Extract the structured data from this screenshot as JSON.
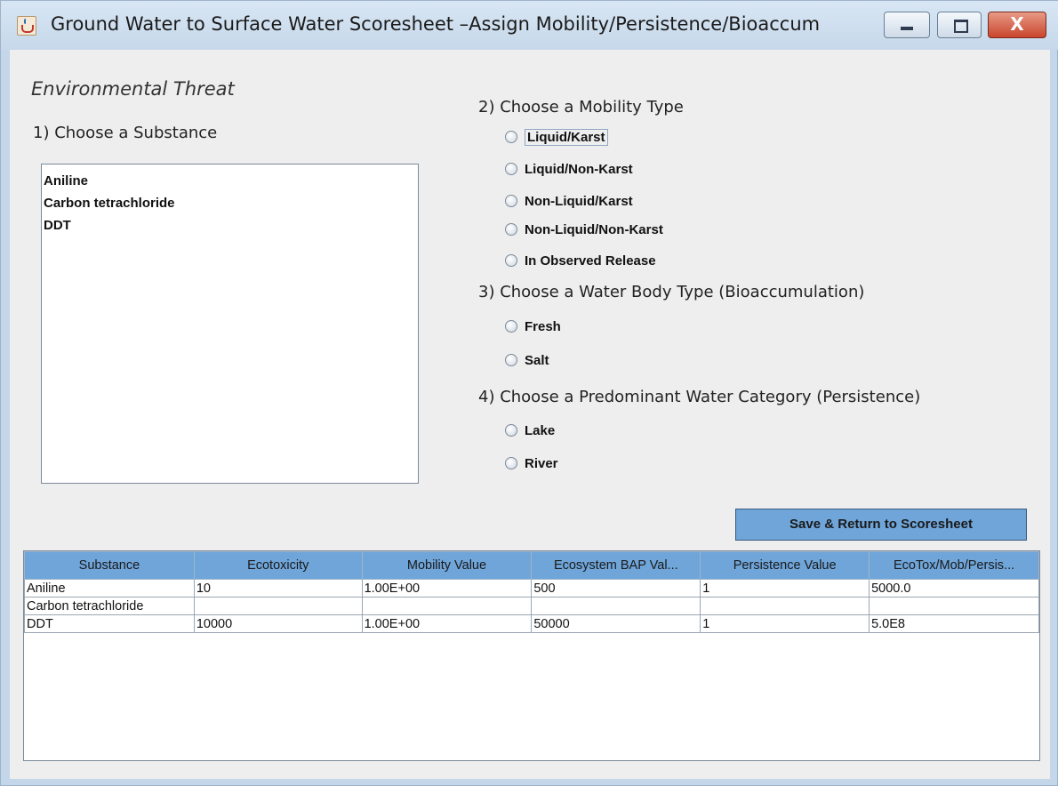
{
  "window": {
    "title": "Ground Water to Surface Water Scoresheet –Assign Mobility/Persistence/Bioaccum",
    "close_glyph": "X"
  },
  "section": {
    "heading": "Environmental Threat"
  },
  "step1": {
    "label": "1) Choose a Substance",
    "items": [
      "Aniline",
      "Carbon tetrachloride",
      "DDT"
    ]
  },
  "step2": {
    "label": "2) Choose a Mobility Type",
    "options": [
      "Liquid/Karst",
      "Liquid/Non-Karst",
      "Non-Liquid/Karst",
      "Non-Liquid/Non-Karst",
      "In Observed Release"
    ]
  },
  "step3": {
    "label": "3) Choose a Water Body Type (Bioaccumulation)",
    "options": [
      "Fresh",
      "Salt"
    ]
  },
  "step4": {
    "label": "4) Choose a Predominant Water Category (Persistence)",
    "options": [
      "Lake",
      "River"
    ]
  },
  "save_button": {
    "label": "Save & Return to Scoresheet"
  },
  "table": {
    "headers": [
      "Substance",
      "Ecotoxicity",
      "Mobility Value",
      "Ecosystem BAP Val...",
      "Persistence Value",
      "EcoTox/Mob/Persis..."
    ],
    "rows": [
      [
        "Aniline",
        "10",
        "1.00E+00",
        "500",
        "1",
        "5000.0"
      ],
      [
        "Carbon tetrachloride",
        "",
        "",
        "",
        "",
        ""
      ],
      [
        "DDT",
        "10000",
        "1.00E+00",
        "50000",
        "1",
        "5.0E8"
      ]
    ]
  },
  "colors": {
    "accent": "#6fa5d9",
    "titlebar": "#c6d8ea",
    "panel": "#eeeeee"
  }
}
